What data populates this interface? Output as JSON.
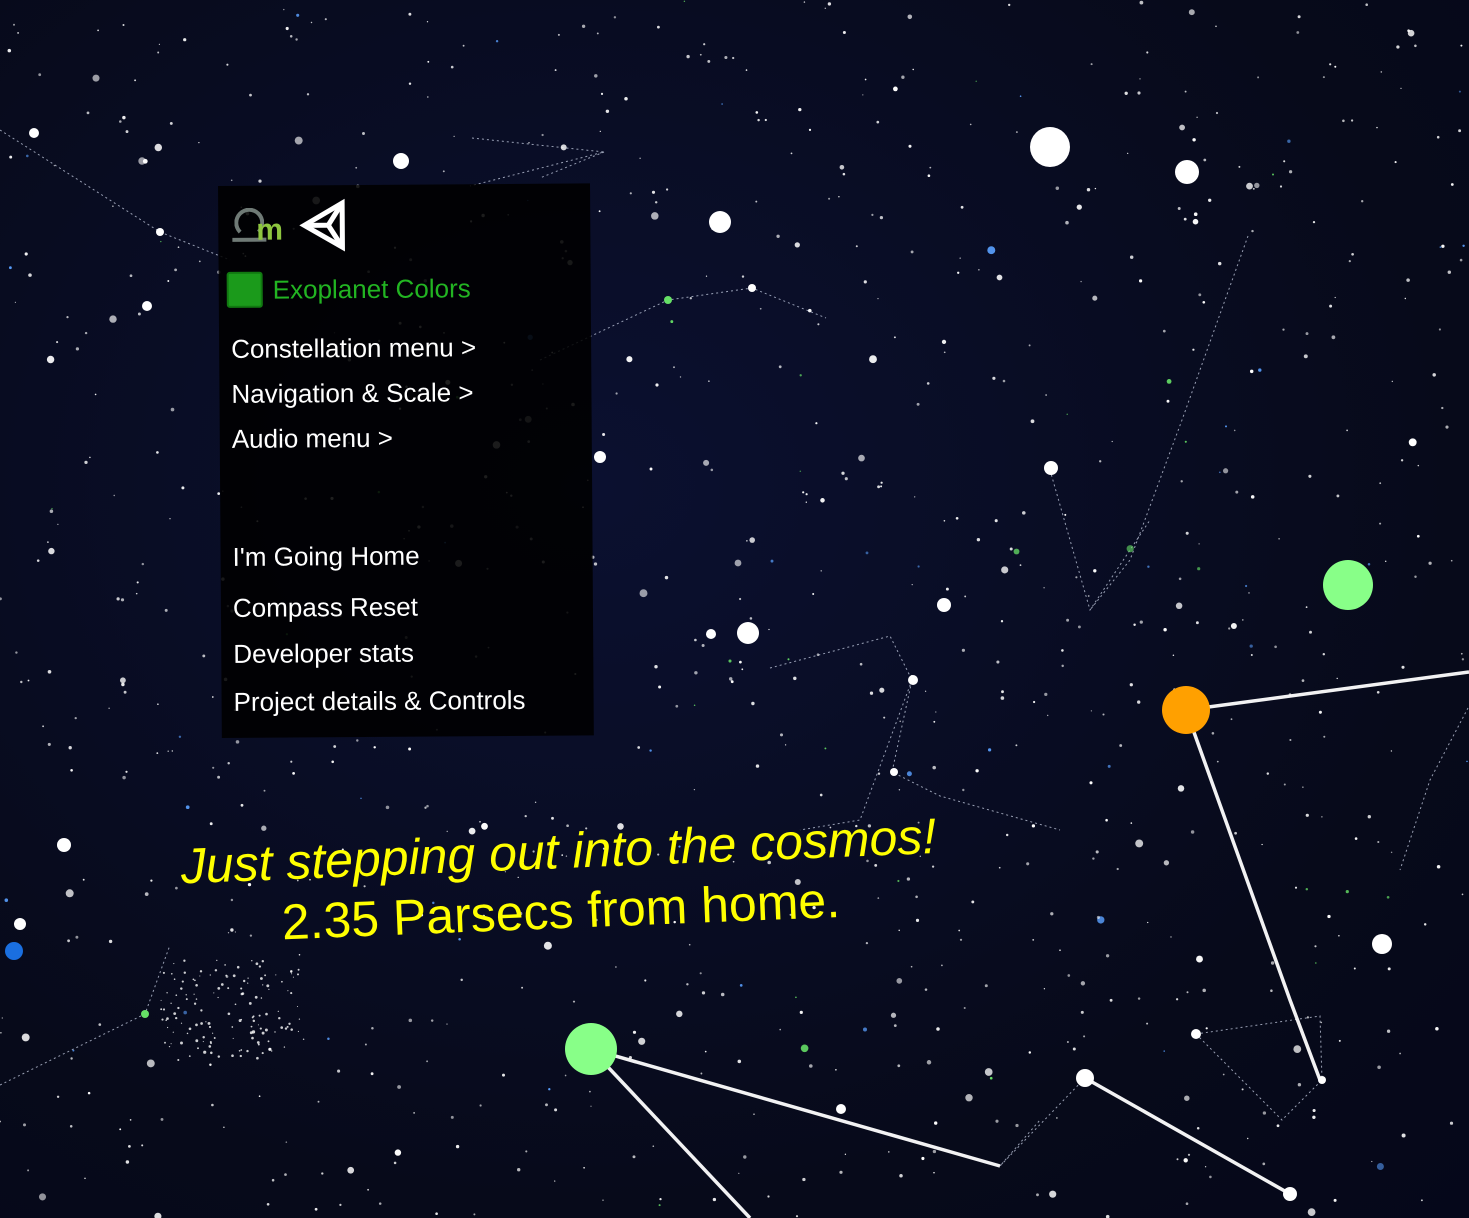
{
  "colors": {
    "background": "#080c1e",
    "panel_background": "#000000",
    "toggle_green": "#1b9a1b",
    "toggle_label_color": "#22b422",
    "menu_text": "#ffffff",
    "caption_color": "#ffff00",
    "planet_green": "#88ff88",
    "planet_orange": "#ffa000",
    "planet_blue": "#1a6fe0"
  },
  "menu": {
    "logos": [
      "omega-m-logo",
      "unity-logo"
    ],
    "exoplanet_toggle": {
      "label": "Exoplanet Colors",
      "checked": true
    },
    "items": [
      {
        "label": "Constellation menu >"
      },
      {
        "label": "Navigation & Scale >"
      },
      {
        "label": "Audio menu >"
      },
      {
        "label": "I'm Going Home"
      },
      {
        "label": "Compass Reset"
      },
      {
        "label": "Developer stats"
      },
      {
        "label": "Project details & Controls"
      }
    ]
  },
  "caption": {
    "line1": "Just stepping out into the cosmos!",
    "line2": "2.35 Parsecs from home."
  }
}
